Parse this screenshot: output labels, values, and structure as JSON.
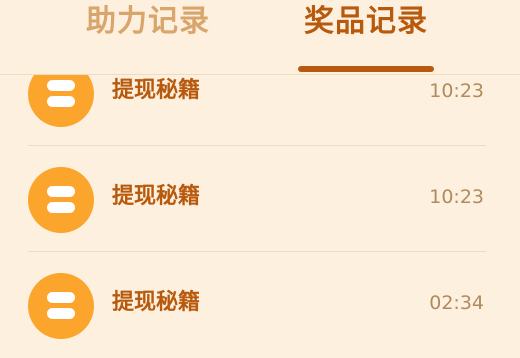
{
  "tabs": {
    "help_record": "助力记录",
    "prize_record": "奖品记录"
  },
  "records": [
    {
      "title": "提现秘籍",
      "time": "10:23",
      "icon": "coin-stack-icon"
    },
    {
      "title": "提现秘籍",
      "time": "10:23",
      "icon": "coin-stack-icon"
    },
    {
      "title": "提现秘籍",
      "time": "02:34",
      "icon": "coin-stack-icon"
    }
  ],
  "colors": {
    "background": "#fdf0df",
    "active_tab": "#b85a0e",
    "inactive_tab": "#d9a56b",
    "icon_circle": "#fba52c",
    "time_text": "#b08b5d"
  }
}
